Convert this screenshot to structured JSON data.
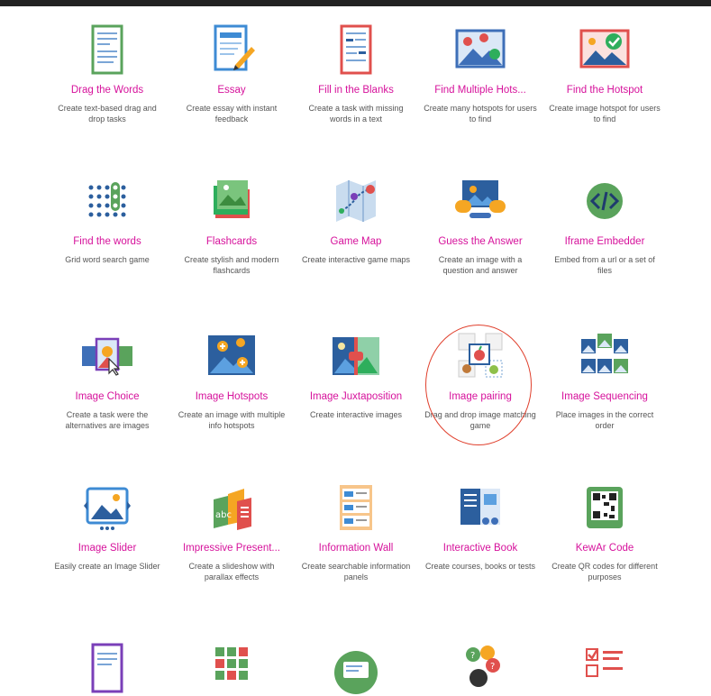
{
  "content_types": [
    {
      "name": "drag-the-words",
      "icon": "drag-words-icon",
      "title": "Drag the Words",
      "desc": "Create text-based drag and drop tasks"
    },
    {
      "name": "essay",
      "icon": "essay-icon",
      "title": "Essay",
      "desc": "Create essay with instant feedback"
    },
    {
      "name": "fill-in-the-blanks",
      "icon": "fill-blanks-icon",
      "title": "Fill in the Blanks",
      "desc": "Create a task with missing words in a text"
    },
    {
      "name": "find-multiple-hotspots",
      "icon": "multiple-hotspots-icon",
      "title": "Find Multiple Hots...",
      "desc": "Create many hotspots for users to find"
    },
    {
      "name": "find-the-hotspot",
      "icon": "hotspot-icon",
      "title": "Find the Hotspot",
      "desc": "Create image hotspot for users to find"
    },
    {
      "name": "find-the-words",
      "icon": "word-search-icon",
      "title": "Find the words",
      "desc": "Grid word search game"
    },
    {
      "name": "flashcards",
      "icon": "flashcards-icon",
      "title": "Flashcards",
      "desc": "Create stylish and modern flashcards"
    },
    {
      "name": "game-map",
      "icon": "game-map-icon",
      "title": "Game Map",
      "desc": "Create interactive game maps"
    },
    {
      "name": "guess-the-answer",
      "icon": "guess-answer-icon",
      "title": "Guess the Answer",
      "desc": "Create an image with a question and answer"
    },
    {
      "name": "iframe-embedder",
      "icon": "code-icon",
      "title": "Iframe Embedder",
      "desc": "Embed from a url or a set of files"
    },
    {
      "name": "image-choice",
      "icon": "image-choice-icon",
      "title": "Image Choice",
      "desc": "Create a task were the alternatives are images"
    },
    {
      "name": "image-hotspots",
      "icon": "image-hotspots-icon",
      "title": "Image Hotspots",
      "desc": "Create an image with multiple info hotspots"
    },
    {
      "name": "image-juxtaposition",
      "icon": "juxtaposition-icon",
      "title": "Image Juxtaposition",
      "desc": "Create interactive images"
    },
    {
      "name": "image-pairing",
      "icon": "image-pairing-icon",
      "title": "Image pairing",
      "desc": "Drag and drop image matching game"
    },
    {
      "name": "image-sequencing",
      "icon": "image-sequencing-icon",
      "title": "Image Sequencing",
      "desc": "Place images in the correct order"
    },
    {
      "name": "image-slider",
      "icon": "image-slider-icon",
      "title": "Image Slider",
      "desc": "Easily create an Image Slider"
    },
    {
      "name": "impressive-presentation",
      "icon": "presentation-icon",
      "title": "Impressive Present...",
      "desc": "Create a slideshow with parallax effects"
    },
    {
      "name": "information-wall",
      "icon": "information-wall-icon",
      "title": "Information Wall",
      "desc": "Create searchable information panels"
    },
    {
      "name": "interactive-book",
      "icon": "book-icon",
      "title": "Interactive Book",
      "desc": "Create courses, books or tests"
    },
    {
      "name": "kewar-code",
      "icon": "qr-code-icon",
      "title": "KewAr Code",
      "desc": "Create QR codes for different purposes"
    },
    {
      "name": "row5-item-1",
      "icon": "document-icon",
      "title": "",
      "desc": ""
    },
    {
      "name": "row5-item-2",
      "icon": "memory-grid-icon",
      "title": "",
      "desc": ""
    },
    {
      "name": "row5-item-3",
      "icon": "search-panel-icon",
      "title": "",
      "desc": ""
    },
    {
      "name": "row5-item-4",
      "icon": "questions-icon",
      "title": "",
      "desc": ""
    },
    {
      "name": "row5-item-5",
      "icon": "checklist-icon",
      "title": "",
      "desc": ""
    }
  ],
  "colors": {
    "title": "#d6119b",
    "desc": "#555555",
    "highlight": "#e0402d"
  }
}
